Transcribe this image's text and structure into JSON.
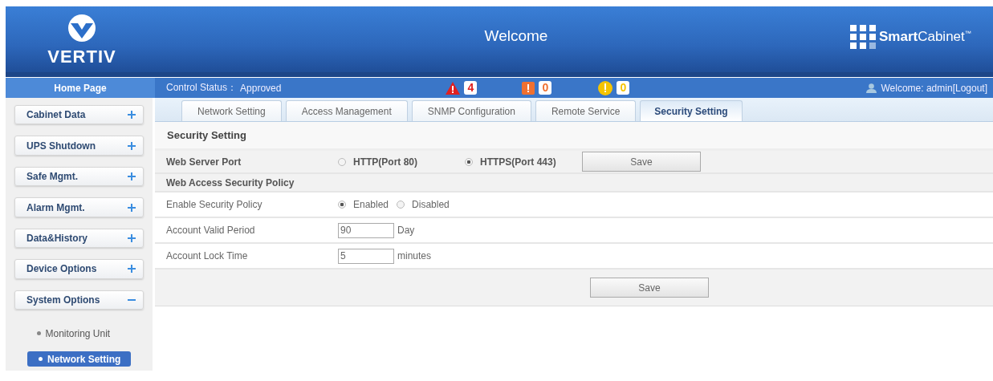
{
  "header": {
    "logo": "VERTIV",
    "title": "Welcome",
    "brand": "**Smart**Cabinet$^{™}$"
  },
  "status_bar": {
    "home": "Home Page",
    "control_label": "Control Status：",
    "control_value": "Approved",
    "alarms": [
      {
        "kind": "critical",
        "count": "4",
        "color": "#e02020"
      },
      {
        "kind": "major",
        "count": "0",
        "color": "#f07030"
      },
      {
        "kind": "minor",
        "count": "0",
        "color": "#f5c400"
      }
    ],
    "user": "Welcome: admin[Logout]"
  },
  "sidebar": {
    "items": [
      {
        "label": "Cabinet Data",
        "expanded": false
      },
      {
        "label": "UPS Shutdown",
        "expanded": false
      },
      {
        "label": "Safe Mgmt.",
        "expanded": false
      },
      {
        "label": "Alarm Mgmt.",
        "expanded": false
      },
      {
        "label": "Data&History",
        "expanded": false
      },
      {
        "label": "Device Options",
        "expanded": false
      },
      {
        "label": "System Options",
        "expanded": true,
        "children": [
          {
            "label": "Monitoring Unit",
            "selected": false
          },
          {
            "label": "Network Setting",
            "selected": true
          }
        ]
      }
    ]
  },
  "tabs": [
    {
      "label": "Network Setting",
      "selected": false
    },
    {
      "label": "Access Management",
      "selected": false
    },
    {
      "label": "SNMP Configuration",
      "selected": false
    },
    {
      "label": "Remote Service",
      "selected": false
    },
    {
      "label": "Security Setting",
      "selected": true
    }
  ],
  "section_title": "Security Setting",
  "rows": [
    {
      "kind": "radio",
      "bold": true,
      "label": "Web Server Port",
      "options": [
        {
          "label": "HTTP(Port 80)",
          "selected": false
        },
        {
          "label": "HTTPS(Port 443)",
          "selected": true
        }
      ],
      "button": "Save"
    },
    {
      "kind": "subheader",
      "label": "Web Access Security Policy"
    },
    {
      "kind": "radio",
      "bold": false,
      "label": "Enable Security Policy",
      "options": [
        {
          "label": "Enabled",
          "selected": true
        },
        {
          "label": "Disabled",
          "selected": false
        }
      ]
    },
    {
      "kind": "input",
      "label": "Account Valid Period",
      "value": "90",
      "unit": "Day"
    },
    {
      "kind": "input",
      "label": "Account Lock Time",
      "value": "5",
      "unit": "minutes"
    }
  ],
  "footer_button": "Save"
}
